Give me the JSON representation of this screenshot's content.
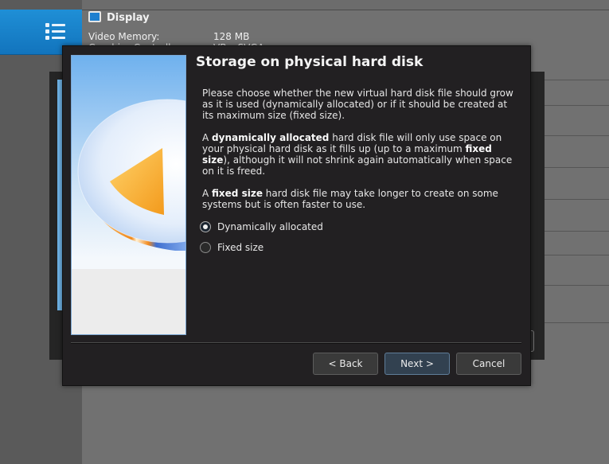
{
  "background": {
    "section_title": "Display",
    "video_memory_label": "Video Memory:",
    "video_memory_value": "128 MB",
    "graphics_controller_label": "Graphics Controller:",
    "graphics_controller_value": "VBoxSVGA"
  },
  "dialog": {
    "title": "Storage on physical hard disk",
    "paragraph1": "Please choose whether the new virtual hard disk file should grow as it is used (dynamically allocated) or if it should be created at its maximum size (fixed size).",
    "p2_prefix": "A ",
    "p2_bold1": "dynamically allocated",
    "p2_mid": " hard disk file will only use space on your physical hard disk as it fills up (up to a maximum ",
    "p2_bold2": "fixed size",
    "p2_suffix": "), although it will not shrink again automatically when space on it is freed.",
    "p3_prefix": "A ",
    "p3_bold": "fixed size",
    "p3_suffix": " hard disk file may take longer to create on some systems but is often faster to use.",
    "options": [
      {
        "label": "Dynamically allocated",
        "checked": true
      },
      {
        "label": "Fixed size",
        "checked": false
      }
    ],
    "buttons": {
      "back": "< Back",
      "next": "Next >",
      "cancel": "Cancel"
    }
  },
  "colors": {
    "accent": "#1f8fd6",
    "dialog_bg": "#222022",
    "default_button": "#324150"
  }
}
